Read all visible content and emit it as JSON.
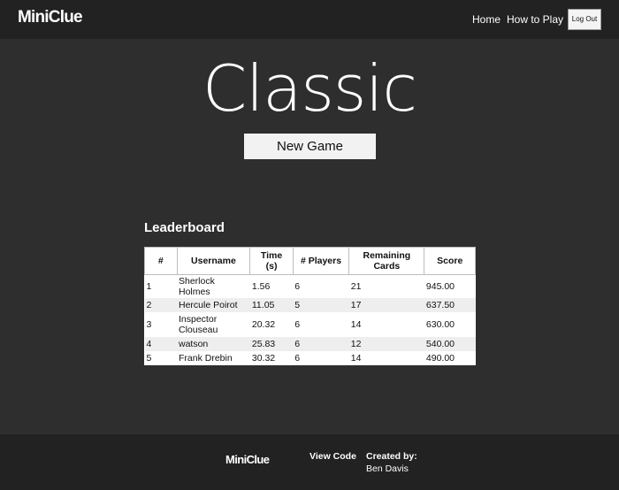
{
  "nav": {
    "brand": "MiniClue",
    "home_label": "Home",
    "howto_label": "How to Play",
    "logout_label": "Log Out"
  },
  "main": {
    "title": "Classic",
    "new_game_label": "New Game"
  },
  "leaderboard": {
    "heading": "Leaderboard",
    "headers": [
      "#",
      "Username",
      "Time (s)",
      "# Players",
      "Remaining Cards",
      "Score"
    ],
    "rows": [
      {
        "rank": "1",
        "username": "Sherlock Holmes",
        "time": "1.56",
        "players": "6",
        "remaining": "21",
        "score": "945.00"
      },
      {
        "rank": "2",
        "username": "Hercule Poirot",
        "time": "11.05",
        "players": "5",
        "remaining": "17",
        "score": "637.50"
      },
      {
        "rank": "3",
        "username": "Inspector Clouseau",
        "time": "20.32",
        "players": "6",
        "remaining": "14",
        "score": "630.00"
      },
      {
        "rank": "4",
        "username": "watson",
        "time": "25.83",
        "players": "6",
        "remaining": "12",
        "score": "540.00"
      },
      {
        "rank": "5",
        "username": "Frank Drebin",
        "time": "30.32",
        "players": "6",
        "remaining": "14",
        "score": "490.00"
      }
    ]
  },
  "footer": {
    "brand": "MiniClue",
    "view_code_label": "View Code",
    "created_by_label": "Created by:",
    "author": "Ben Davis"
  },
  "colors": {
    "page_bg": "#2e2e2e",
    "nav_bg": "#222222",
    "footer_bg": "#222222",
    "button_bg": "#f2f2f2",
    "row_alt_bg": "#eeeeee"
  }
}
